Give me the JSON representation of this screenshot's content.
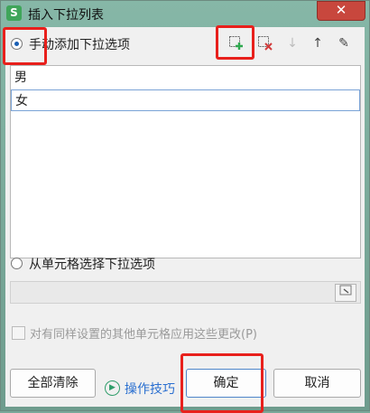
{
  "window": {
    "app_icon_letter": "S",
    "title": "插入下拉列表",
    "close_glyph": "✕"
  },
  "manual": {
    "label": "手动添加下拉选项",
    "selected": true,
    "toolbar": {
      "add_icon": "add-item-icon",
      "delete_icon": "delete-item-icon",
      "down_icon": "move-down-icon",
      "up_icon": "move-up-icon",
      "edit_icon": "edit-icon"
    },
    "items": [
      "男",
      "女"
    ]
  },
  "from_cells": {
    "label": "从单元格选择下拉选项",
    "selected": false,
    "range_value": ""
  },
  "apply_same": {
    "label": "对有同样设置的其他单元格应用这些更改(P)",
    "checked": false,
    "enabled": false
  },
  "buttons": {
    "clear_all": "全部清除",
    "tips": "操作技巧",
    "ok": "确定",
    "cancel": "取消"
  },
  "colors": {
    "highlight": "#e8201c",
    "accent": "#1a5fb4",
    "add_green": "#2fa84f",
    "delete_red": "#d23a3a"
  }
}
